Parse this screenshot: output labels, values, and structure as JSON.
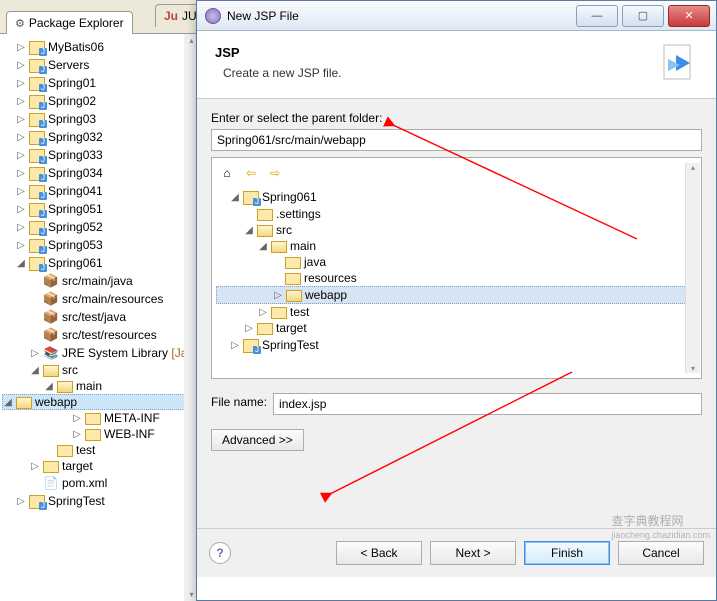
{
  "tabs": {
    "pkg": "Package Explorer",
    "junit": "JUni"
  },
  "explorer": {
    "MyBatis06": "MyBatis06",
    "Servers": "Servers",
    "Spring01": "Spring01",
    "Spring02": "Spring02",
    "Spring03": "Spring03",
    "Spring032": "Spring032",
    "Spring033": "Spring033",
    "Spring034": "Spring034",
    "Spring041": "Spring041",
    "Spring051": "Spring051",
    "Spring052": "Spring052",
    "Spring053": "Spring053",
    "Spring061": "Spring061",
    "src_main_java": "src/main/java",
    "src_main_resources": "src/main/resources",
    "src_test_java": "src/test/java",
    "src_test_resources": "src/test/resources",
    "jre": "JRE System Library",
    "jre_suffix": " [Jav",
    "src": "src",
    "main": "main",
    "webapp": "webapp",
    "META_INF": "META-INF",
    "WEB_INF": "WEB-INF",
    "test": "test",
    "target": "target",
    "pom": "pom.xml",
    "SpringTest": "SpringTest"
  },
  "dialog": {
    "title": "New JSP File",
    "heading": "JSP",
    "subheading": "Create a new JSP file.",
    "parent_label": "Enter or select the parent folder:",
    "parent_value": "Spring061/src/main/webapp",
    "browser": {
      "Spring061": "Spring061",
      "settings": ".settings",
      "src": "src",
      "main": "main",
      "java": "java",
      "resources": "resources",
      "webapp": "webapp",
      "test": "test",
      "target": "target",
      "SpringTest": "SpringTest"
    },
    "filename_label": "File name:",
    "filename_value": "index.jsp",
    "advanced": "Advanced >>",
    "back": "< Back",
    "next": "Next >",
    "finish": "Finish",
    "cancel": "Cancel"
  },
  "watermark": {
    "main": "查字典教程网",
    "sub": "jiaocheng.chazidian.com"
  }
}
